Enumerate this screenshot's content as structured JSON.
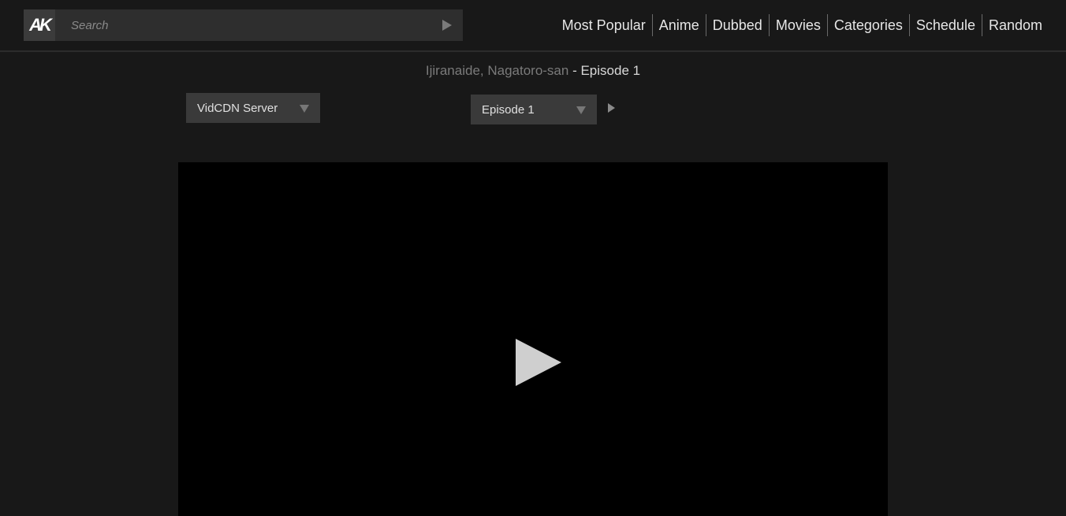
{
  "header": {
    "logo_text": "AK",
    "search": {
      "placeholder": "Search",
      "value": ""
    },
    "nav": [
      "Most Popular",
      "Anime",
      "Dubbed",
      "Movies",
      "Categories",
      "Schedule",
      "Random"
    ]
  },
  "title": {
    "series": "Ijiranaide, Nagatoro-san",
    "separator": " - ",
    "episode": "Episode 1"
  },
  "controls": {
    "server_selected": "VidCDN Server",
    "episode_selected": "Episode 1"
  },
  "icons": {
    "search_submit": "play-triangle-icon",
    "dropdown": "chevron-down-icon",
    "next": "next-icon",
    "player": "play-icon"
  },
  "colors": {
    "background": "#181818",
    "header_border": "#2c2c2c",
    "search_bg": "#2e2e2e",
    "select_bg": "#3a3a3a",
    "player_bg": "#000000",
    "series_link": "#7a7a7a"
  }
}
